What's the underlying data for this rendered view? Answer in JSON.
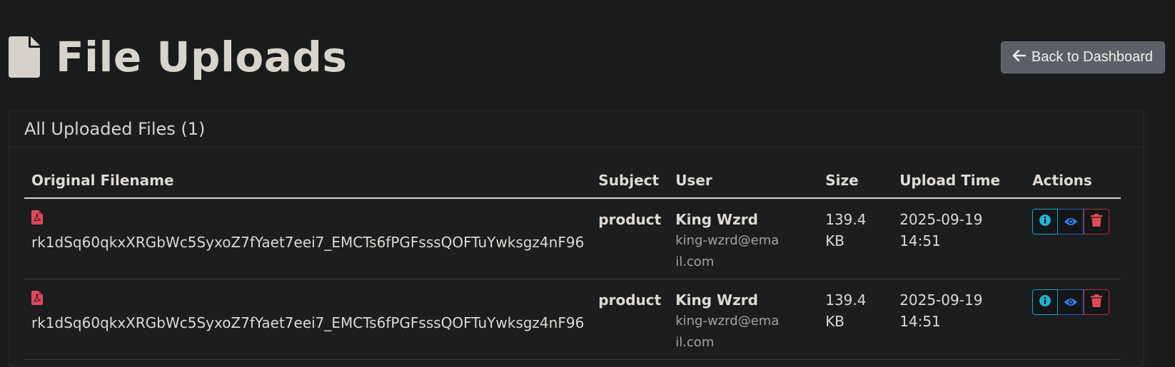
{
  "page": {
    "title": "File Uploads",
    "title_icon": "file-icon",
    "back_button_label": "Back to Dashboard",
    "back_button_icon": "arrow-left-icon"
  },
  "card": {
    "title": "All Uploaded Files (1)"
  },
  "table": {
    "columns": [
      "Original Filename",
      "Subject",
      "User",
      "Size",
      "Upload Time",
      "Actions"
    ],
    "rows": [
      {
        "file_icon": "pdf-file-icon",
        "filename": "rk1dSq60qkxXRGbWc5SyxoZ7fYaet7eei7_EMCTs6fPGFsssQOFTuYwksgz4nF96",
        "subject": "product",
        "user_name": "King Wzrd",
        "user_email": "king-wzrd@email.com",
        "size": "139.4 KB",
        "upload_time": "2025-09-19 14:51"
      },
      {
        "file_icon": "pdf-file-icon",
        "filename": "rk1dSq60qkxXRGbWc5SyxoZ7fYaet7eei7_EMCTs6fPGFsssQOFTuYwksgz4nF96",
        "subject": "product",
        "user_name": "King Wzrd",
        "user_email": "king-wzrd@email.com",
        "size": "139.4 KB",
        "upload_time": "2025-09-19 14:51"
      }
    ]
  },
  "colors": {
    "background": "#1a1b1d",
    "pdf_red": "#e0485a",
    "info_cyan": "#1fb3d0",
    "view_blue": "#2f7ff0",
    "delete_red": "#e04a55",
    "back_button": "#5b6066"
  }
}
